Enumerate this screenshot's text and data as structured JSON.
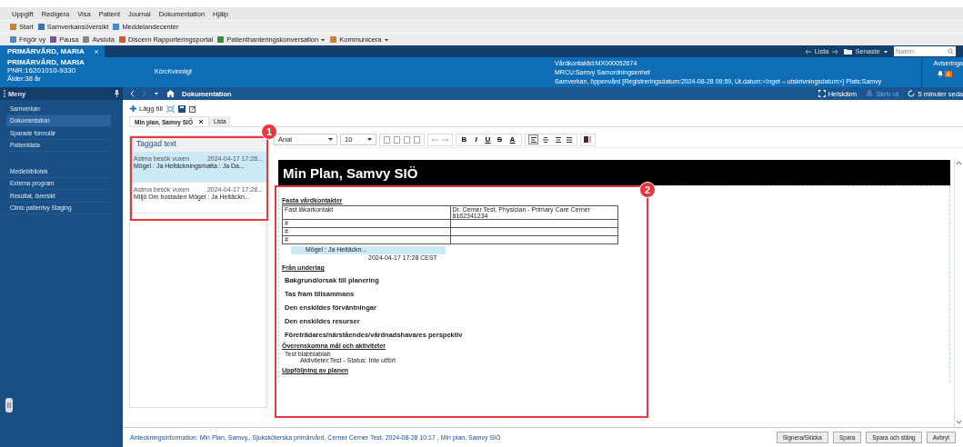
{
  "menu_bar": [
    "Uppgift",
    "Redigera",
    "Visa",
    "Patient",
    "Journal",
    "Dokumentation",
    "Hjälp"
  ],
  "toolbar_1": [
    "Start",
    "Samverkansöversikt",
    "Meddelandecenter"
  ],
  "toolbar_2": [
    {
      "label": "Frigör vy",
      "dropdown": false
    },
    {
      "label": "Pausa",
      "dropdown": false
    },
    {
      "label": "Avsluta",
      "dropdown": false
    },
    {
      "label": "Discern Rapporteringsportal",
      "dropdown": false
    },
    {
      "label": "Patienthanteringskonversation",
      "dropdown": true
    },
    {
      "label": "Kommunicera",
      "dropdown": true
    }
  ],
  "patient_tab": {
    "name": "PRIMÄRVÅRD, MARIA"
  },
  "top_nav": {
    "list": "Lista",
    "recent": "Senaste",
    "search_placeholder": "Namn"
  },
  "patient_header": {
    "name": "PRIMÄRVÅRD, MARIA",
    "pnr": "PNR:16201010-9330",
    "age": "Ålder:38 år",
    "gender": "KörcKvinnligt",
    "encounter": [
      "Vårdkontaktid:MX000052674",
      "MRCU:Samvy Samordningsenhet",
      "Samverkan, öppenvård [Registreringsdatum:2024-08-28 09:59, Ut.datum:<Inget – utskrivningsdatum>] Plats:Samvy"
    ],
    "notifications": {
      "label": "Aviseringa",
      "count": "4"
    }
  },
  "sidebar": {
    "title": "Meny",
    "groups": [
      [
        {
          "label": "Samverkan",
          "selected": false
        },
        {
          "label": "Dokumentation",
          "selected": true
        },
        {
          "label": "Sparade formulär",
          "selected": false
        },
        {
          "label": "Patientdata",
          "selected": false
        }
      ],
      [
        {
          "label": "Mediebibliotek",
          "selected": false
        },
        {
          "label": "Externa program",
          "selected": false
        },
        {
          "label": "Resultat, översikt",
          "selected": false
        },
        {
          "label": "Clinic patientvy Staging",
          "selected": false
        }
      ]
    ]
  },
  "nav_bar": {
    "title": "Dokumentation",
    "actions": [
      {
        "label": "Helskärm",
        "disabled": false
      },
      {
        "label": "Skriv ut",
        "disabled": true
      },
      {
        "label": "5 minuter seda",
        "disabled": false
      }
    ]
  },
  "doc_toolbar": {
    "add": "Lägg till"
  },
  "doc_tabs": [
    {
      "label": "Min plan, Samvy SIÖ",
      "selected": true,
      "closable": true
    },
    {
      "label": "Lista",
      "selected": false,
      "closable": false
    }
  ],
  "tagged_text": {
    "title": "Taggad text",
    "items": [
      {
        "title": "Astma besök vuxen",
        "date": "2024-04-17 17:28...",
        "text": "Mögel :  Ja  Heltäckningsmatta :  Ja  Da...",
        "selected": true
      },
      {
        "title": "Astma besök vuxen",
        "date": "2024-04-17 17:28...",
        "text": "Miljö Om bostaden  Mögel :  Ja  Heltäckn...",
        "selected": false
      }
    ]
  },
  "editor_toolbar": {
    "font": "Arial",
    "size": "10",
    "format_buttons": [
      "B",
      "I",
      "U",
      "S"
    ],
    "color_button": "A",
    "align": [
      {
        "selected": true
      },
      {
        "selected": false
      },
      {
        "selected": false
      },
      {
        "selected": false
      }
    ]
  },
  "document": {
    "title": "Min Plan, Samvy SIÖ",
    "blocks": [
      {
        "kind": "heading",
        "text": "Fasta vårdkontakter"
      },
      {
        "kind": "table",
        "rows": [
          {
            "cells": [
              [
                "Fast läkarkontakt"
              ],
              [
                "Dr. Cerner Test, Physician - Primary Care Cerner",
                "8162341234"
              ]
            ]
          },
          {
            "cells": [
              [
                "#"
              ]
            ]
          },
          {
            "cells": [
              [
                "#"
              ]
            ]
          },
          {
            "cells": [
              [
                "#"
              ]
            ]
          }
        ]
      },
      {
        "kind": "tag",
        "text": "Mögel :  Ja  Heltäckn...",
        "date": "2024-04-17 17:28 CEST"
      },
      {
        "kind": "heading",
        "text": "Från underlag"
      },
      {
        "kind": "bold",
        "text": "Bakgrund/orsak till planering"
      },
      {
        "kind": "bold",
        "text": "Tas fram tillsammans"
      },
      {
        "kind": "bold",
        "text": "Den enskildes förväntningar"
      },
      {
        "kind": "bold",
        "text": "Den enskildes resurser"
      },
      {
        "kind": "bold",
        "text": "Företrädares/närståendes/vårdnadshavares perspektiv"
      },
      {
        "kind": "heading",
        "text": "Överenskomna mål och aktiviteter"
      },
      {
        "kind": "bullet",
        "text": "Test blabblablab",
        "sub": "Aktiviteter:Test - Status: Inte utfört"
      },
      {
        "kind": "heading",
        "text": "Uppföljning av planen"
      }
    ]
  },
  "footer": {
    "info": "Anteckningsinformation: Min Plan, Samvy,, Sjuksköterska primärvård, Cerner Cerner Test, 2024-08-28 10:17 , Min plan, Samvy SIÖ",
    "buttons": [
      "Signera/Skicka",
      "Spara",
      "Spara och stäng",
      "Avbryt"
    ]
  },
  "callouts": [
    {
      "number": "1"
    },
    {
      "number": "2"
    }
  ]
}
